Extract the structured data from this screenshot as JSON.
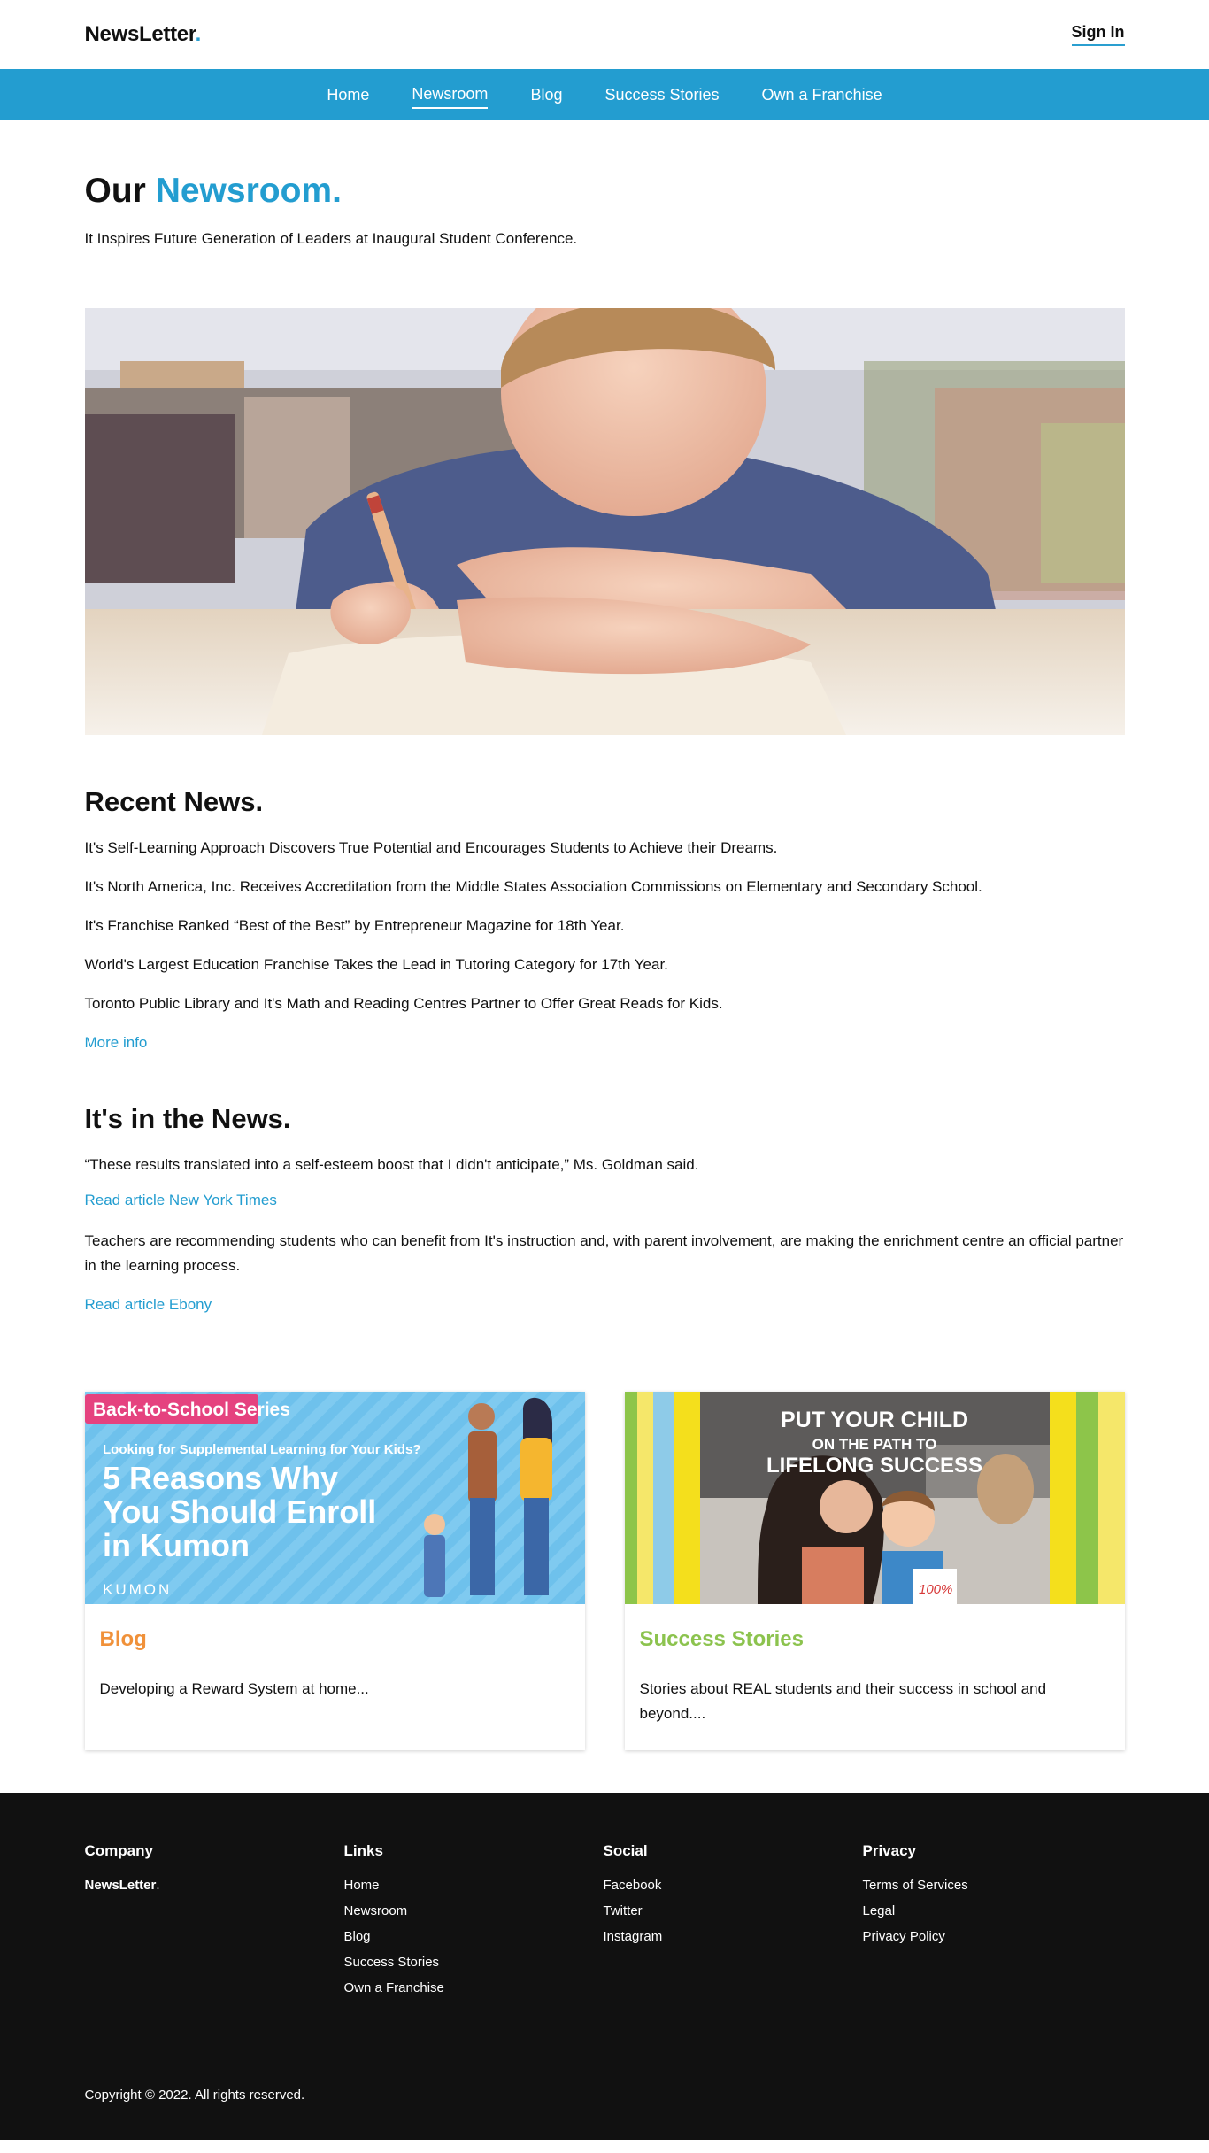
{
  "header": {
    "logo": "NewsLetter",
    "logo_dot": ".",
    "signin": "Sign In"
  },
  "nav": {
    "items": [
      {
        "label": "Home"
      },
      {
        "label": "Newsroom"
      },
      {
        "label": "Blog"
      },
      {
        "label": "Success Stories"
      },
      {
        "label": "Own a Franchise"
      }
    ],
    "active": "Newsroom"
  },
  "newsroom": {
    "title_prefix": "Our",
    "title_accent": "Newsroom.",
    "subtitle": "It Inspires Future Generation of Leaders at Inaugural Student Conference."
  },
  "recent": {
    "heading": "Recent News.",
    "items": [
      "It's Self-Learning Approach Discovers True Potential and Encourages Students to Achieve their Dreams.",
      "It's North America, Inc. Receives Accreditation from the Middle States Association Commissions on Elementary and Secondary School.",
      "It's Franchise Ranked “Best of the Best” by Entrepreneur Magazine for 18th Year.",
      "World's Largest Education Franchise Takes the Lead in Tutoring Category for 17th Year.",
      "Toronto Public Library and It's Math and Reading Centres Partner to Offer Great Reads for Kids."
    ],
    "more": "More info"
  },
  "inthenews": {
    "heading": "It's in the News.",
    "quote": "“These results translated into a self-esteem boost that I didn't anticipate,” Ms. Goldman said.",
    "link1": "Read article New York Times",
    "para": "Teachers are recommending students who can benefit from It's instruction and, with parent involvement, are making the enrichment centre an official partner in the learning process.",
    "link2": "Read article Ebony"
  },
  "cards": [
    {
      "title": "Blog",
      "desc": "Developing a Reward System at home...",
      "image": {
        "badge": "Back-to-School Series",
        "kicker": "Looking for Supplemental Learning for Your Kids?",
        "headline": [
          "5 Reasons Why",
          "You Should Enroll",
          "in Kumon"
        ],
        "brand": "KUMON"
      }
    },
    {
      "title": "Success Stories",
      "desc": "Stories about REAL students and their success in school and beyond....",
      "image": {
        "line1": "PUT YOUR CHILD",
        "line2": "ON THE PATH TO",
        "line3": "LIFELONG SUCCESS",
        "paper": "100%"
      }
    }
  ],
  "footer": {
    "company": {
      "heading": "Company",
      "brand": "NewsLetter",
      "brand_dot": "."
    },
    "links": {
      "heading": "Links",
      "items": [
        "Home",
        "Newsroom",
        "Blog",
        "Success Stories",
        "Own a Franchise"
      ]
    },
    "social": {
      "heading": "Social",
      "items": [
        "Facebook",
        "Twitter",
        "Instagram"
      ]
    },
    "privacy": {
      "heading": "Privacy",
      "items": [
        "Terms of Services",
        "Legal",
        "Privacy Policy"
      ]
    },
    "copyright": "Copyright © 2022. All rights reserved."
  },
  "colors": {
    "accent": "#239dd0",
    "blog": "#f0913a",
    "success": "#8cc34e",
    "footer_bg": "#111111"
  }
}
